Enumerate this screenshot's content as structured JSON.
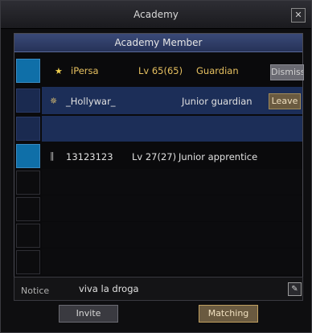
{
  "window": {
    "title": "Academy",
    "close_glyph": "✕"
  },
  "panel": {
    "header": "Academy Member"
  },
  "members": [
    {
      "name": "iPersa",
      "level": "Lv 65(65)",
      "role": "Guardian",
      "action": "Dismiss",
      "icon": "star-icon"
    },
    {
      "name": "_Hollywar_",
      "level": "",
      "role": "Junior guardian",
      "action": "Leave",
      "icon": "star-outline-icon"
    },
    {
      "name": "13123123",
      "level": "Lv 27(27)",
      "role": "Junior apprentice",
      "action": "",
      "icon": "rank-bar-icon"
    }
  ],
  "notice": {
    "label": "Notice",
    "value": "viva la droga",
    "edit_glyph": "✎"
  },
  "buttons": {
    "invite": "Invite",
    "matching": "Matching"
  }
}
